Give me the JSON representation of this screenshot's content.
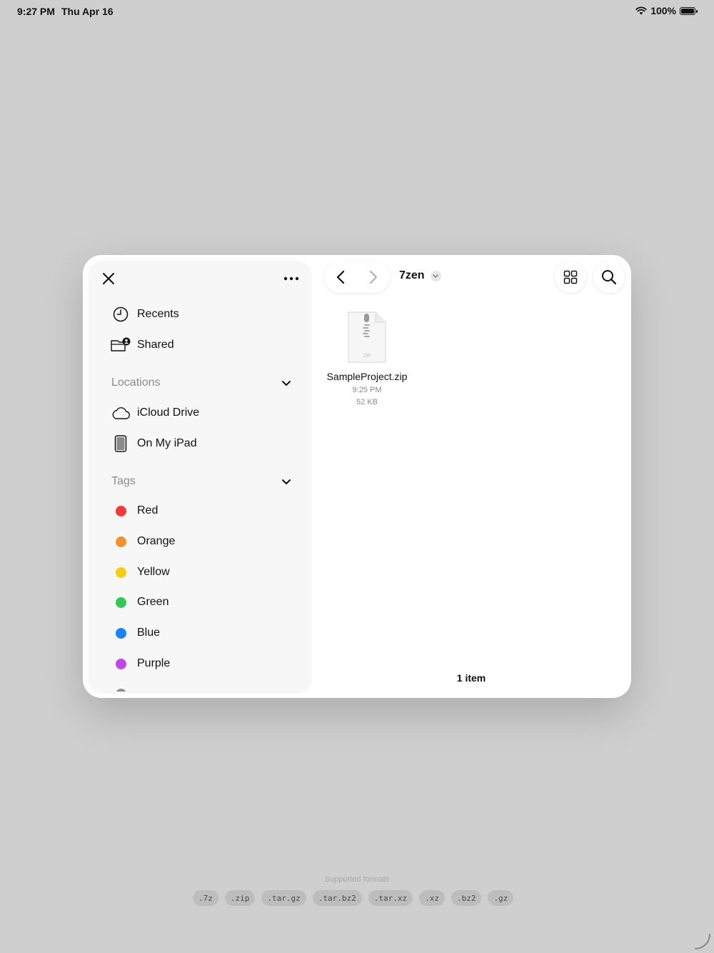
{
  "status_bar": {
    "time": "9:27 PM",
    "date": "Thu Apr 16",
    "battery": "100%"
  },
  "sidebar": {
    "close_icon": "close-icon",
    "more_icon": "ellipsis-icon",
    "favorites": [
      {
        "label": "Recents",
        "icon": "clock-icon"
      },
      {
        "label": "Shared",
        "icon": "shared-folder-icon"
      }
    ],
    "locations": {
      "header": "Locations",
      "items": [
        {
          "label": "iCloud Drive",
          "icon": "cloud-icon"
        },
        {
          "label": "On My iPad",
          "icon": "ipad-icon"
        }
      ]
    },
    "tags": {
      "header": "Tags",
      "items": [
        {
          "label": "Red",
          "color": "#f23a3a"
        },
        {
          "label": "Orange",
          "color": "#f5902e"
        },
        {
          "label": "Yellow",
          "color": "#f7cc19"
        },
        {
          "label": "Green",
          "color": "#34c659"
        },
        {
          "label": "Blue",
          "color": "#1a82fb"
        },
        {
          "label": "Purple",
          "color": "#c247e0"
        }
      ]
    }
  },
  "toolbar": {
    "folder_title": "7zen"
  },
  "files": [
    {
      "name": "SampleProject.zip",
      "time": "9:25 PM",
      "size": "52 KB",
      "type_label": "ZIP"
    }
  ],
  "footer": {
    "item_count": "1 item"
  },
  "supported": {
    "label": "Supported formats",
    "formats": [
      ".7z",
      ".zip",
      ".tar.gz",
      ".tar.bz2",
      ".tar.xz",
      ".xz",
      ".bz2",
      ".gz"
    ]
  }
}
